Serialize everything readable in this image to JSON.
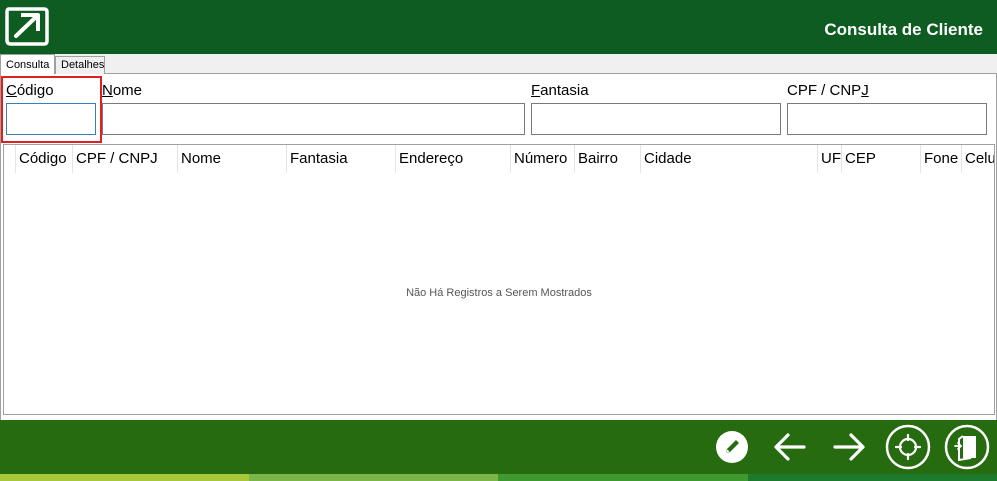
{
  "window": {
    "title": "Consulta de Cliente"
  },
  "tabs": [
    {
      "label": "Consulta"
    },
    {
      "label": "Detalhes"
    }
  ],
  "fields": {
    "codigo": {
      "label_first": "C",
      "label_rest": "ódigo",
      "value": ""
    },
    "nome": {
      "label_first": "N",
      "label_rest": "ome",
      "value": ""
    },
    "fantasia": {
      "label_first": "F",
      "label_rest": "antasia",
      "value": ""
    },
    "cpf": {
      "label_first": "CPF / CNP",
      "label_rest": "J",
      "value": ""
    }
  },
  "grid": {
    "columns": [
      "Código",
      "CPF / CNPJ",
      "Nome",
      "Fantasia",
      "Endereço",
      "Número",
      "Bairro",
      "Cidade",
      "UF",
      "CEP",
      "Fone",
      "Celu"
    ],
    "rows": [],
    "empty_message": "Não Há Registros a Serem Mostrados"
  },
  "footer": {
    "buttons": [
      "edit-icon",
      "arrow-left-icon",
      "arrow-right-icon",
      "crosshair-icon",
      "exit-door-icon"
    ]
  },
  "colors": {
    "header_bg": "#0e5c22",
    "footer_bg": "#276b10",
    "highlight": "#e01f1f",
    "stripes": [
      "#a8c83a",
      "#7ab648",
      "#3e9a2e",
      "#1b7a2c"
    ]
  }
}
